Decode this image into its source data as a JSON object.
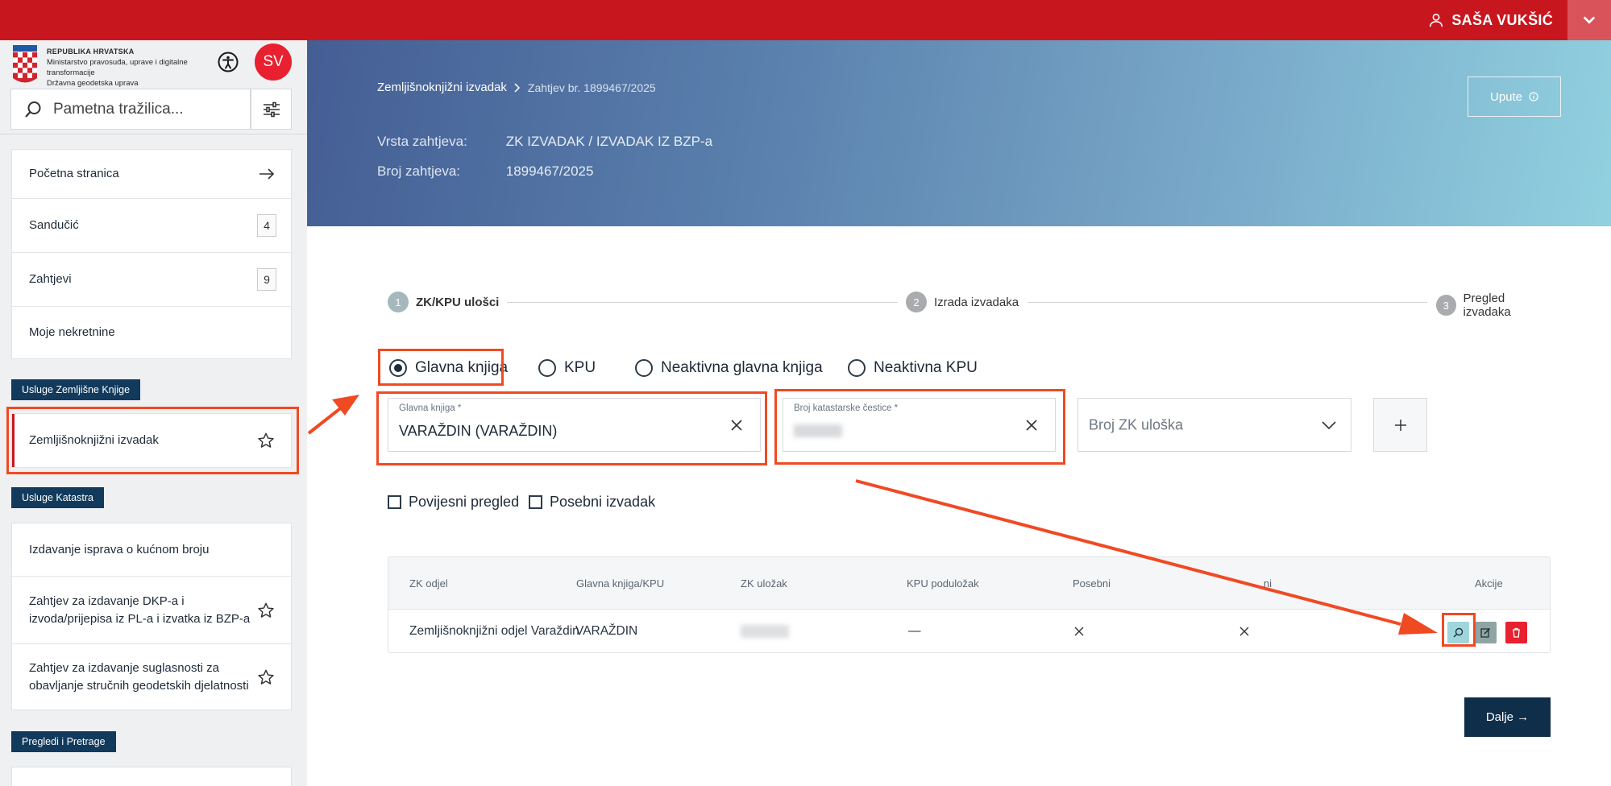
{
  "topbar": {
    "user_name": "SAŠA VUKŠIĆ"
  },
  "brand": {
    "line1": "REPUBLIKA HRVATSKA",
    "line2": "Ministarstvo pravosuđa, uprave i digitalne transformacije",
    "line3": "Državna geodetska uprava"
  },
  "avatar": {
    "initials": "SV"
  },
  "search": {
    "placeholder": "Pametna tražilica..."
  },
  "nav_main": [
    {
      "label": "Početna stranica"
    },
    {
      "label": "Sandučić",
      "count": "4"
    },
    {
      "label": "Zahtjevi",
      "count": "9"
    },
    {
      "label": "Moje nekretnine"
    }
  ],
  "sections": {
    "zk": {
      "label": "Usluge Zemljišne Knjige",
      "items": [
        {
          "label": "Zemljišnoknjižni izvadak"
        }
      ]
    },
    "katastar": {
      "label": "Usluge Katastra",
      "items": [
        {
          "label": "Izdavanje isprava o kućnom broju"
        },
        {
          "label": "Zahtjev za izdavanje DKP-a i izvoda/prijepisa iz PL-a i izvatka iz BZP-a"
        },
        {
          "label": "Zahtjev za izdavanje suglasnosti za obavljanje stručnih geodetskih djelatnosti"
        }
      ]
    },
    "pregledi": {
      "label": "Pregledi i Pretrage"
    }
  },
  "hero": {
    "breadcrumb_root": "Zemljišnoknjižni izvadak",
    "breadcrumb_current": "Zahtjev br. 1899467/2025",
    "vrsta_label": "Vrsta zahtjeva:",
    "vrsta_value": "ZK IZVADAK / IZVADAK IZ BZP-a",
    "broj_label": "Broj zahtjeva:",
    "broj_value": "1899467/2025",
    "upute_label": "Upute"
  },
  "steps": [
    {
      "num": "1",
      "label": "ZK/KPU ulošci"
    },
    {
      "num": "2",
      "label": "Izrada izvadaka"
    },
    {
      "num": "3",
      "label": "Pregled izvadaka"
    }
  ],
  "radios": [
    {
      "label": "Glavna knjiga",
      "selected": true
    },
    {
      "label": "KPU",
      "selected": false
    },
    {
      "label": "Neaktivna glavna knjiga",
      "selected": false
    },
    {
      "label": "Neaktivna KPU",
      "selected": false
    }
  ],
  "form": {
    "glavna_label": "Glavna knjiga *",
    "glavna_value": "VARAŽDIN (VARAŽDIN)",
    "cestica_label": "Broj katastarske čestice *",
    "ulozak_placeholder": "Broj ZK uloška"
  },
  "checks": [
    {
      "label": "Povijesni pregled"
    },
    {
      "label": "Posebni izvadak"
    }
  ],
  "table": {
    "headers": [
      "ZK odjel",
      "Glavna knjiga/KPU",
      "ZK uložak",
      "KPU poduložak",
      "Posebni",
      "...ni",
      "Akcije"
    ],
    "row": {
      "odjel": "Zemljišnoknjižni odjel Varaždin",
      "glavna": "VARAŽDIN",
      "kpu": "—"
    }
  },
  "dalje_label": "Dalje →",
  "colors": {
    "brand_red": "#c8161e",
    "navy": "#113a5c",
    "annotation": "#f04a23"
  }
}
